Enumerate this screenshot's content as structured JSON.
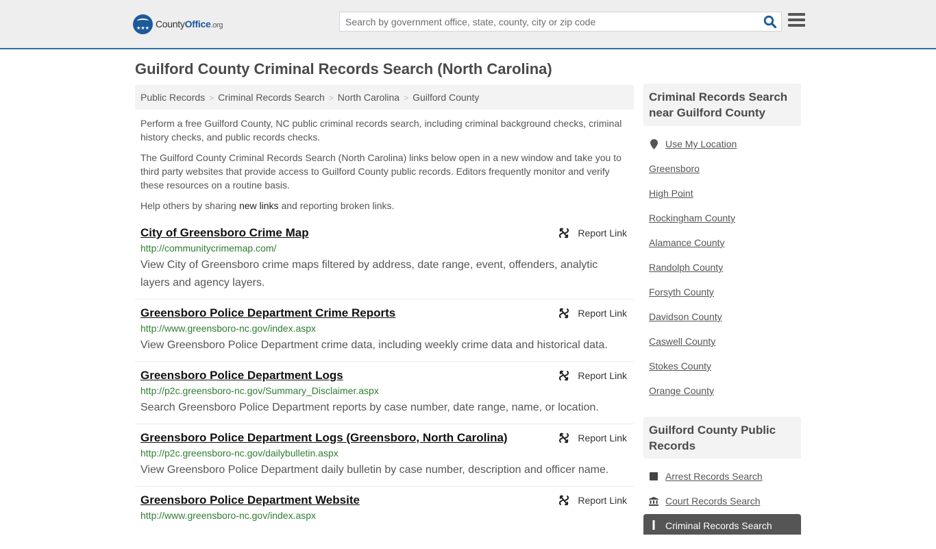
{
  "header": {
    "logo": {
      "brand_pre": "County",
      "brand_main": "Office",
      "brand_tld": ".org",
      "stars": "★★★"
    },
    "search": {
      "placeholder": "Search by government office, state, county, city or zip code",
      "value": ""
    },
    "colors": {
      "accent": "#1c5a9b",
      "header_bg": "#eeeeee",
      "header_border": "#2f6fa8"
    }
  },
  "page": {
    "title": "Guilford County Criminal Records Search (North Carolina)",
    "breadcrumb": [
      "Public Records",
      "Criminal Records Search",
      "North Carolina",
      "Guilford County"
    ],
    "breadcrumb_sep": ">",
    "intro": {
      "p1": "Perform a free Guilford County, NC public criminal records search, including criminal background checks, criminal history checks, and public records checks.",
      "p2": "The Guilford County Criminal Records Search (North Carolina) links below open in a new window and take you to third party websites that provide access to Guilford County public records. Editors frequently monitor and verify these resources on a routine basis.",
      "p3_before": "Help others by sharing ",
      "p3_link": "new links",
      "p3_after": " and reporting broken links."
    },
    "report_label": "Report Link",
    "listings": [
      {
        "title": "City of Greensboro Crime Map",
        "url": "http://communitycrimemap.com/",
        "desc": "View City of Greensboro crime maps filtered by address, date range, event, offenders, analytic layers and agency layers."
      },
      {
        "title": "Greensboro Police Department Crime Reports",
        "url": "http://www.greensboro-nc.gov/index.aspx",
        "desc": "View Greensboro Police Department crime data, including weekly crime data and historical data."
      },
      {
        "title": "Greensboro Police Department Logs",
        "url": "http://p2c.greensboro-nc.gov/Summary_Disclaimer.aspx",
        "desc": "Search Greensboro Police Department reports by case number, date range, name, or location."
      },
      {
        "title": "Greensboro Police Department Logs (Greensboro, North Carolina)",
        "url": "http://p2c.greensboro-nc.gov/dailybulletin.aspx",
        "desc": "View Greensboro Police Department daily bulletin by case number, description and officer name."
      },
      {
        "title": "Greensboro Police Department Website",
        "url": "http://www.greensboro-nc.gov/index.aspx",
        "desc": ""
      }
    ]
  },
  "sidebar": {
    "nearby": {
      "heading": "Criminal Records Search near Guilford County",
      "use_location": "Use My Location",
      "links": [
        "Greensboro",
        "High Point",
        "Rockingham County",
        "Alamance County",
        "Randolph County",
        "Forsyth County",
        "Davidson County",
        "Caswell County",
        "Stokes County",
        "Orange County"
      ]
    },
    "public_records": {
      "heading": "Guilford County Public Records",
      "links": [
        {
          "label": "Arrest Records Search",
          "icon": "square-icon"
        },
        {
          "label": "Court Records Search",
          "icon": "courthouse-icon"
        },
        {
          "label": "Criminal Records Search",
          "icon": "exclamation-icon",
          "active": true
        }
      ]
    }
  }
}
